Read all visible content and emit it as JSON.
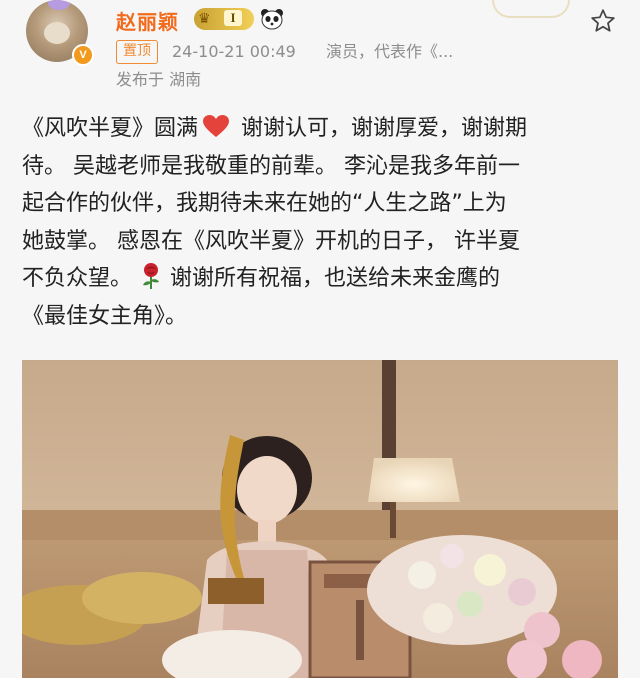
{
  "header": {
    "username": "赵丽颖",
    "vip_level": "I",
    "pinned_label": "置顶",
    "timestamp": "24-10-21 00:49",
    "description": "演员，代表作《...",
    "location": "发布于 湖南"
  },
  "post": {
    "lines": [
      "《风吹半夏》圆满",
      " 谢谢认可，谢谢厚爱，谢谢期",
      "待。 吴越老师是我敬重的前辈。 李沁是我多年前一",
      "起合作的伙伴，我期待未来在她的“人生之路”上为",
      "她鼓掌。 感恩在《风吹半夏》开机的日子， 许半夏",
      "不负众望。",
      "谢谢所有祝福，也送给未来金鹰的",
      "《最佳女主角》。"
    ]
  },
  "icons": {
    "heart": "red-heart-icon",
    "rose": "rose-icon",
    "follow": "star-outline-icon",
    "panda": "panda-icon",
    "vip": "crown-icon"
  },
  "colors": {
    "username": "#f26b1d",
    "pinned": "#f08a34",
    "meta": "#8d8d8d",
    "heart": "#e4433b",
    "vip": "#e5bd45"
  }
}
